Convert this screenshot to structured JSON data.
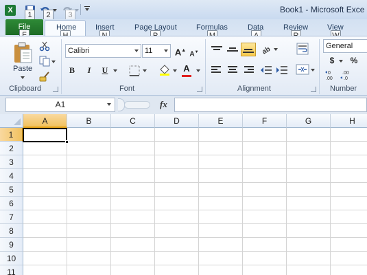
{
  "window": {
    "title": "Book1 - Microsoft Exce"
  },
  "quick_access": {
    "icons": [
      "excel-logo-icon",
      "save-icon",
      "undo-icon",
      "redo-icon",
      "customize-qat-icon"
    ],
    "keytips": [
      "1",
      "2",
      "3"
    ]
  },
  "tabs": [
    {
      "label": "File",
      "keytip": "F"
    },
    {
      "label": "Home",
      "keytip": "H"
    },
    {
      "label": "Insert",
      "keytip": "N"
    },
    {
      "label": "Page Layout",
      "keytip": "P"
    },
    {
      "label": "Formulas",
      "keytip": "M"
    },
    {
      "label": "Data",
      "keytip": "A"
    },
    {
      "label": "Review",
      "keytip": "R"
    },
    {
      "label": "View",
      "keytip": "W"
    }
  ],
  "ribbon": {
    "clipboard": {
      "label": "Clipboard",
      "paste_label": "Paste"
    },
    "font": {
      "label": "Font",
      "font_name": "Calibri",
      "font_size": "11",
      "bold": "B",
      "italic": "I",
      "underline": "U"
    },
    "alignment": {
      "label": "Alignment"
    },
    "number": {
      "label": "Number",
      "format": "General",
      "currency": "$",
      "percent": "%"
    }
  },
  "formula_bar": {
    "name_box": "A1",
    "fx": "fx",
    "content": ""
  },
  "sheet": {
    "columns": [
      "A",
      "B",
      "C",
      "D",
      "E",
      "F",
      "G",
      "H"
    ],
    "rows": [
      "1",
      "2",
      "3",
      "4",
      "5",
      "6",
      "7",
      "8",
      "9",
      "10",
      "11"
    ],
    "active_cell": "A1"
  },
  "colors": {
    "file_tab": "#1d6b26",
    "selection_header": "#f1c15f",
    "ribbon_bg": "#e2eaf5"
  }
}
